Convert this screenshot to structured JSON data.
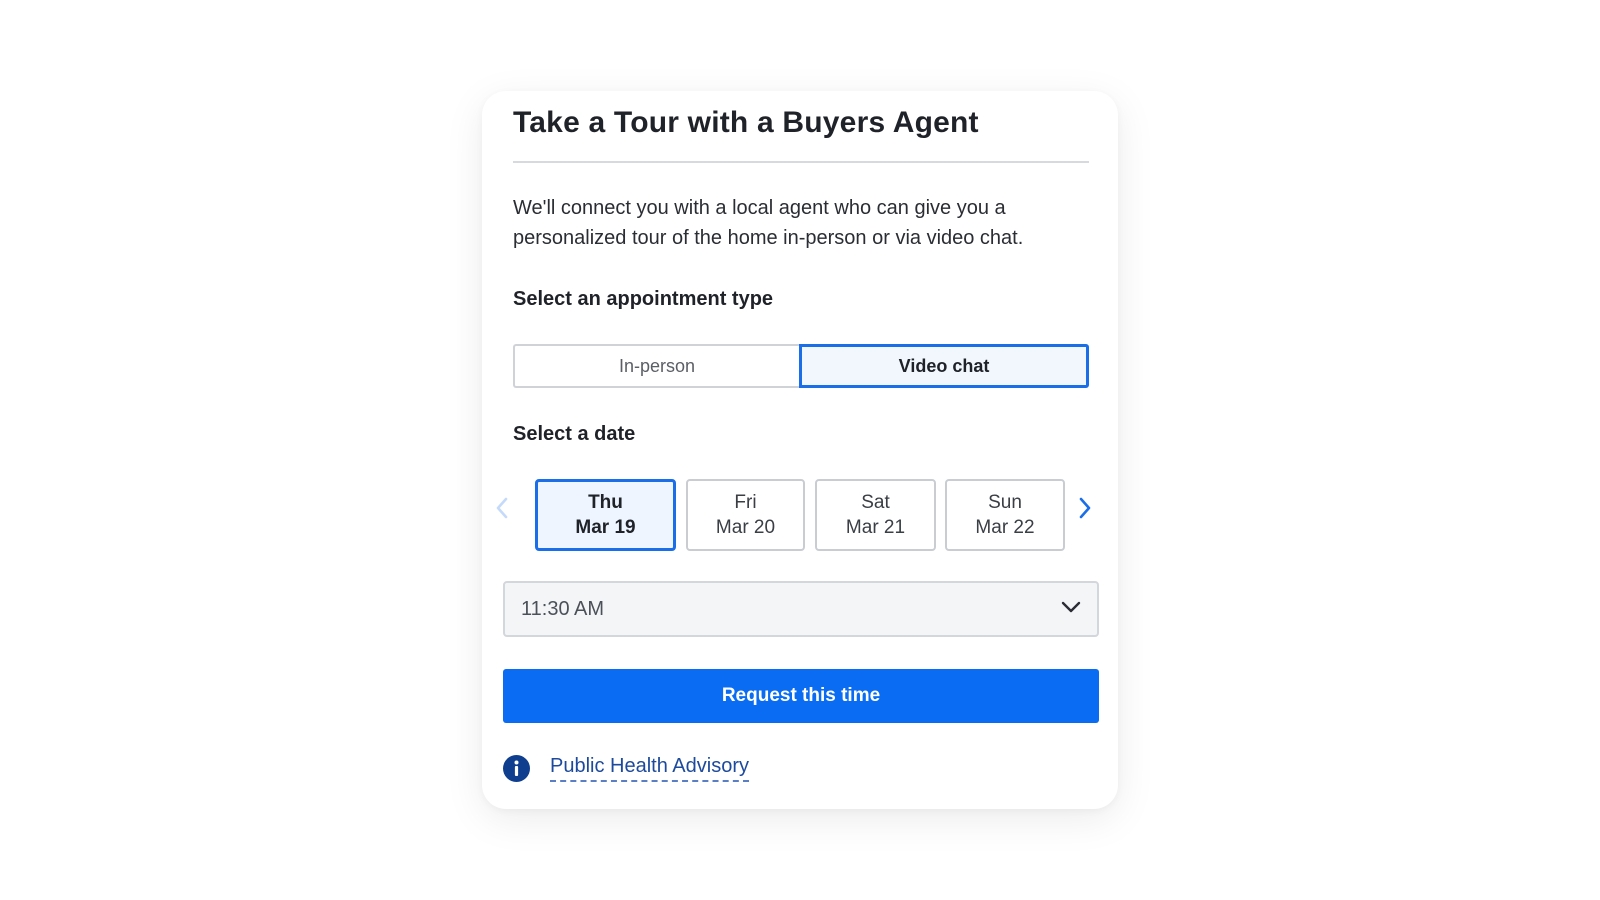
{
  "header": {
    "title": "Take a Tour with a Buyers Agent"
  },
  "intro": "We'll connect you with a local agent who can give you a personalized tour of the home in-person or via video chat.",
  "appointment": {
    "label": "Select an appointment type",
    "options": [
      "In-person",
      "Video chat"
    ],
    "selected": "Video chat"
  },
  "dates": {
    "label": "Select a date",
    "items": [
      {
        "day": "Thu",
        "date": "Mar 19"
      },
      {
        "day": "Fri",
        "date": "Mar 20"
      },
      {
        "day": "Sat",
        "date": "Mar 21"
      },
      {
        "day": "Sun",
        "date": "Mar 22"
      }
    ],
    "selected": "Thu Mar 19",
    "prev_icon": "chevron-left-icon",
    "next_icon": "chevron-right-icon"
  },
  "time": {
    "value": "11:30 AM",
    "icon": "chevron-down-icon"
  },
  "actions": {
    "request_label": "Request this time"
  },
  "advisory": {
    "icon": "info-icon",
    "link_text": "Public Health Advisory"
  },
  "colors": {
    "accent": "#0a6cf2",
    "selected_border": "#1a6ee8",
    "link": "#1c4a9c",
    "info_icon": "#0f3e8f"
  }
}
